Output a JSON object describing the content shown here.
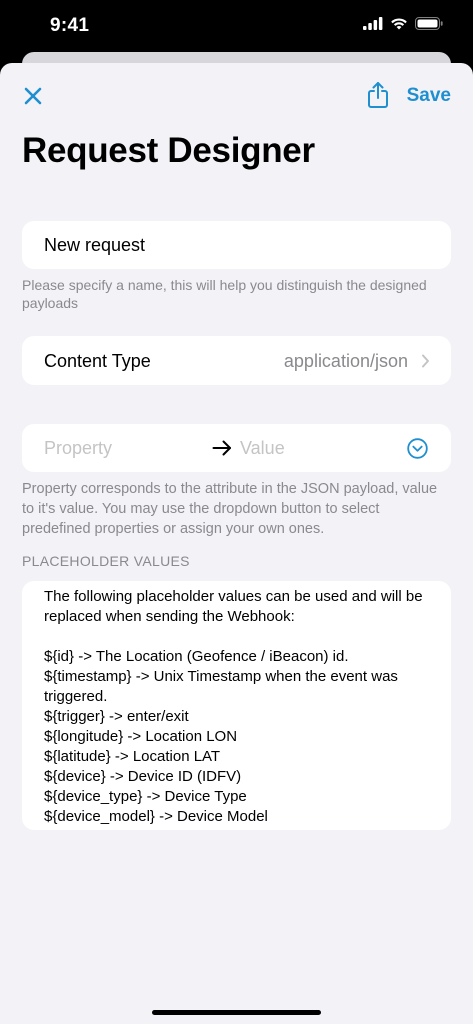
{
  "status_bar": {
    "time": "9:41"
  },
  "nav": {
    "close_icon": "close-icon",
    "share_icon": "share-icon",
    "save_label": "Save"
  },
  "title": "Request Designer",
  "name_field": {
    "value": "New request",
    "hint": "Please specify a name, this will help you distinguish the designed payloads"
  },
  "content_type": {
    "label": "Content Type",
    "value": "application/json"
  },
  "property_row": {
    "property_placeholder": "Property",
    "value_placeholder": "Value",
    "hint": "Property corresponds to the attribute in the JSON payload, value to it's value. You may use the dropdown button to select predefined properties or assign your own ones."
  },
  "placeholder_section": {
    "header": "PLACEHOLDER VALUES",
    "text": "The following placeholder values can be used and will be replaced when sending the Webhook:\n\n${id} -> The Location (Geofence / iBeacon) id.\n${timestamp} -> Unix Timestamp when the event was triggered.\n${trigger} -> enter/exit\n${longitude} -> Location LON\n${latitude} -> Location LAT\n${device} -> Device ID (IDFV)\n${device_type} -> Device Type\n${device_model} -> Device Model"
  },
  "colors": {
    "accent": "#1f8fcf",
    "background": "#f2f2f7",
    "card": "#ffffff",
    "secondary_text": "#8a8a8e",
    "placeholder_text": "#c4c4c7"
  }
}
